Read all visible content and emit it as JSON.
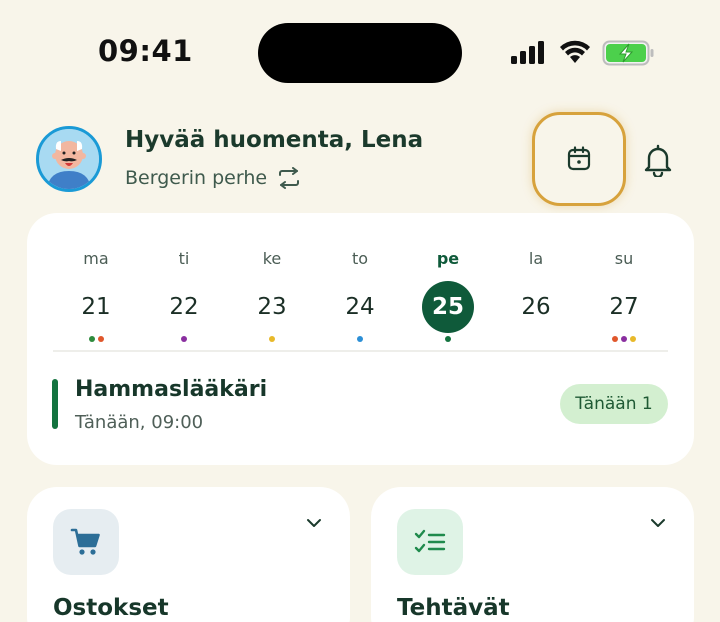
{
  "status_bar": {
    "time": "09:41",
    "icons": [
      "signal-icon",
      "wifi-icon",
      "battery-charging-icon"
    ]
  },
  "header": {
    "greeting": "Hyvää huomenta, Lena",
    "family": "Bergerin perhe",
    "family_switch_icon": "swap-icon",
    "calendar_icon": "calendar-icon",
    "bell_icon": "bell-icon"
  },
  "week": {
    "days": [
      {
        "name": "ma",
        "num": "21",
        "dots": [
          "#2e8b3d",
          "#e0572c"
        ]
      },
      {
        "name": "ti",
        "num": "22",
        "dots": [
          "#8a2fa0"
        ]
      },
      {
        "name": "ke",
        "num": "23",
        "dots": [
          "#e8b92a"
        ]
      },
      {
        "name": "to",
        "num": "24",
        "dots": [
          "#2c8fd6"
        ]
      },
      {
        "name": "pe",
        "num": "25",
        "dots": [
          "#13733f"
        ],
        "active": true
      },
      {
        "name": "la",
        "num": "26",
        "dots": []
      },
      {
        "name": "su",
        "num": "27",
        "dots": [
          "#e0572c",
          "#8a2fa0",
          "#e8b92a"
        ]
      }
    ],
    "event": {
      "title": "Hammaslääkäri",
      "time": "Tänään, 09:00",
      "badge": "Tänään 1"
    }
  },
  "tiles": [
    {
      "title": "Ostokset",
      "icon": "shopping-cart-icon",
      "icon_bg": "#e6edf1",
      "icon_color": "#2c6e97"
    },
    {
      "title": "Tehtävät",
      "icon": "checklist-icon",
      "icon_bg": "#dff3e6",
      "icon_color": "#1f8a4c"
    }
  ],
  "colors": {
    "background": "#f8f5ea",
    "primary": "#0f5a3a",
    "highlight_ring": "#d7a23c",
    "avatar_ring": "#1a9ad6"
  }
}
